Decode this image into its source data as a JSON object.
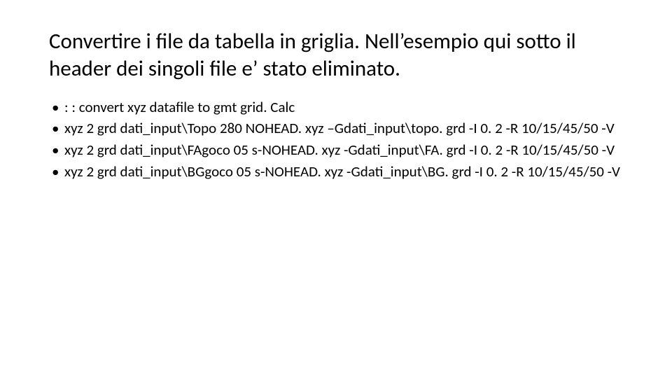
{
  "title": "Convertire i file da tabella in griglia. Nell’esempio qui sotto il header dei singoli file e’ stato eliminato.",
  "bullets": [
    ": : convert xyz datafile to gmt grid. Calc",
    "xyz 2 grd dati_input\\Topo 280 NOHEAD. xyz –Gdati_input\\topo. grd -I 0. 2 -R 10/15/45/50 -V",
    "xyz 2 grd dati_input\\FAgoco 05 s-NOHEAD. xyz -Gdati_input\\FA. grd -I 0. 2 -R 10/15/45/50 -V",
    "xyz 2 grd dati_input\\BGgoco 05 s-NOHEAD. xyz -Gdati_input\\BG. grd -I 0. 2 -R 10/15/45/50 -V"
  ]
}
